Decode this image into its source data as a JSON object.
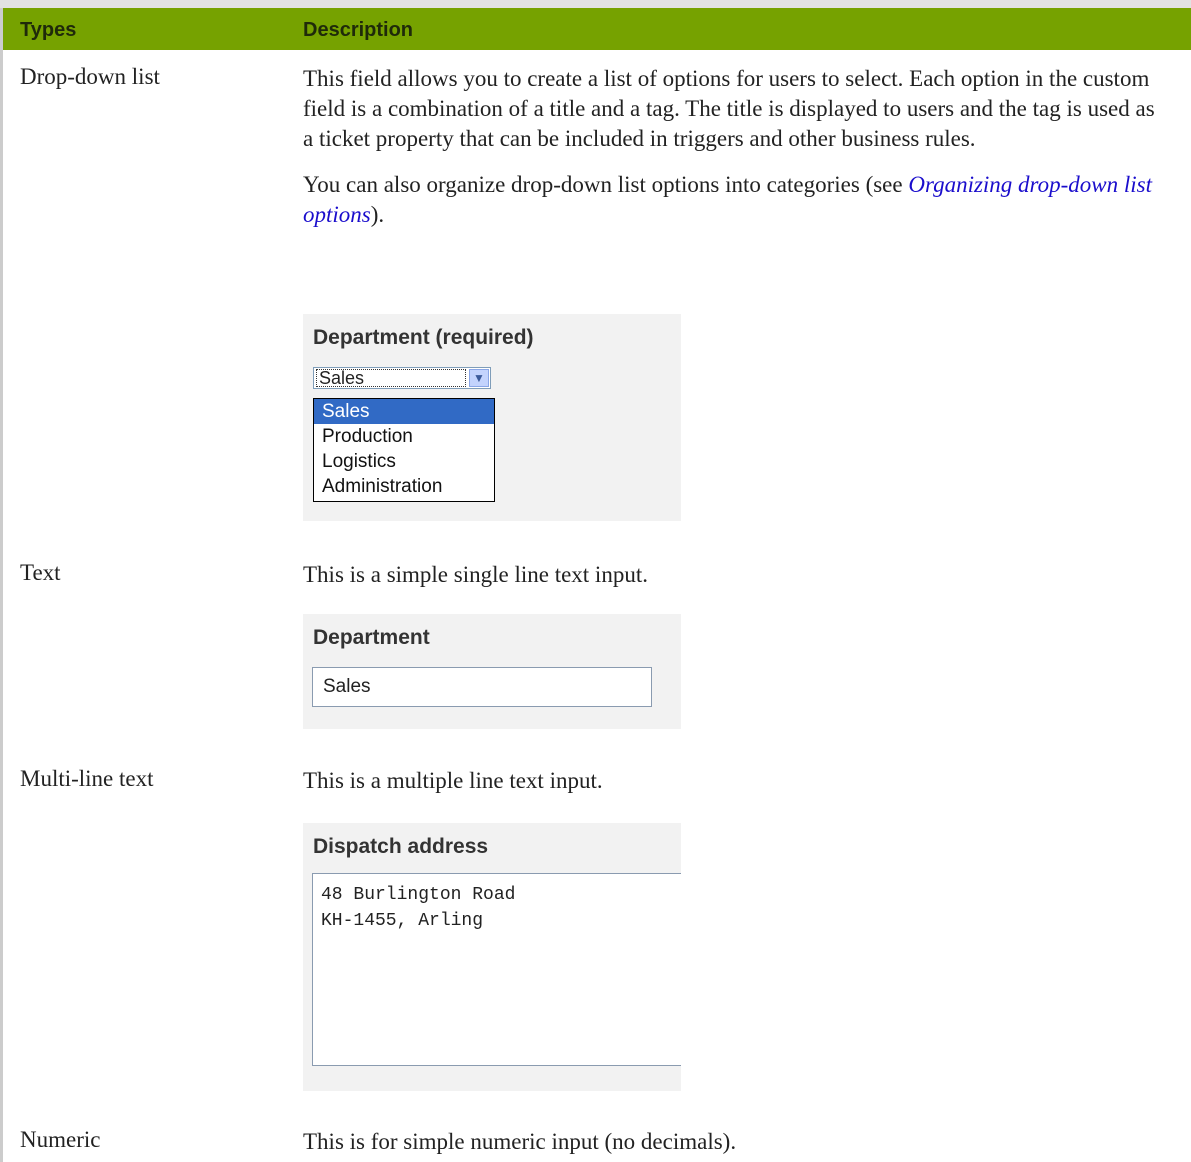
{
  "table": {
    "headers": {
      "types": "Types",
      "description": "Description"
    },
    "rows": [
      {
        "type": "Drop-down list",
        "description": "This field allows you to create a list of options for users to select. Each option in the custom field is a combination of a title and a tag. The title is displayed to users and the tag is used as a ticket property that can be included in triggers and other business rules.",
        "description2_prefix": "You can also organize drop-down list options into categories (see ",
        "description2_link": "Organizing drop-down list options",
        "description2_suffix": ").",
        "example": {
          "label": "Department (required)",
          "selected": "Sales",
          "options": [
            "Sales",
            "Production",
            "Logistics",
            "Administration"
          ]
        }
      },
      {
        "type": "Text",
        "description": "This is a simple single line text input.",
        "example": {
          "label": "Department",
          "value": "Sales"
        }
      },
      {
        "type": "Multi-line text",
        "description": "This is a multiple line text input.",
        "example": {
          "label": "Dispatch address",
          "value": "48 Burlington Road\nKH-1455, Arling"
        }
      },
      {
        "type": "Numeric",
        "description": "This is for simple numeric input (no decimals)."
      }
    ]
  },
  "colors": {
    "header_bg": "#76a200",
    "link": "#1a0dcc",
    "selected_option": "#316ac5"
  },
  "icons": {
    "dropdown_arrow": "chevron-down-icon"
  }
}
